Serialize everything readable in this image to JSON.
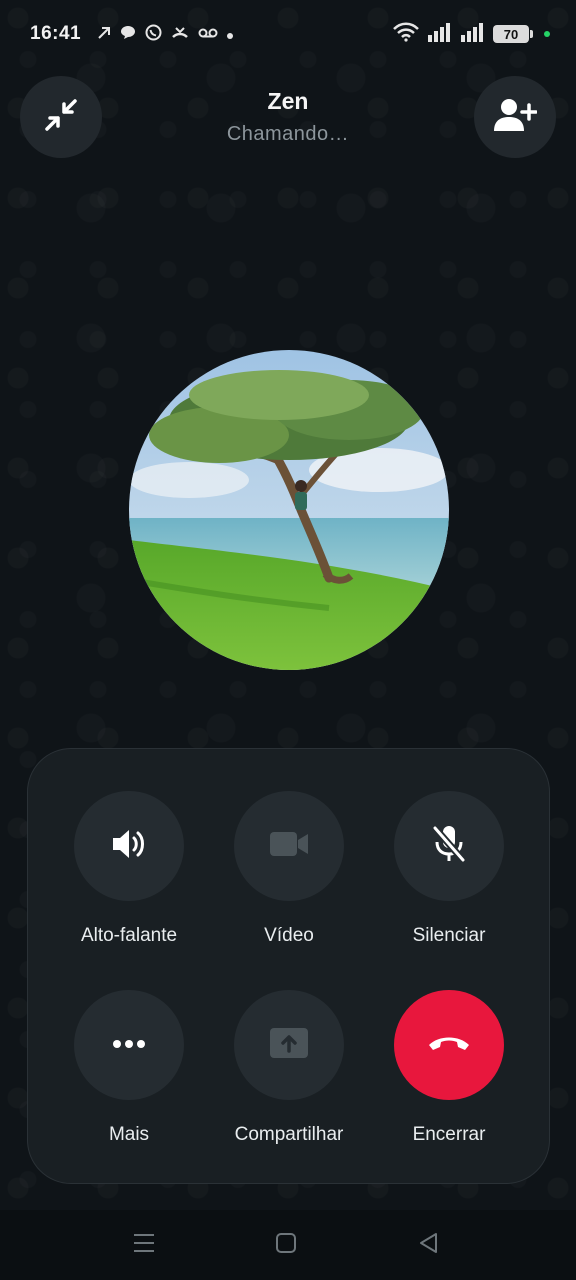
{
  "status_bar": {
    "time": "16:41",
    "battery": "70",
    "notification_icons": [
      "arrow-icon",
      "chat-bubble-icon",
      "whatsapp-icon",
      "missed-call-icon",
      "voicemail-icon",
      "dot-icon"
    ],
    "system_icons": [
      "wifi-icon",
      "signal-icon",
      "signal-icon",
      "battery-icon"
    ],
    "accent_dot_color": "#25d366"
  },
  "header": {
    "contact_name": "Zen",
    "call_status": "Chamando…",
    "left_button_icon": "minimize-icon",
    "right_button_icon": "add-person-icon"
  },
  "controls": [
    {
      "id": "speaker",
      "label": "Alto-falante",
      "icon": "speaker-icon"
    },
    {
      "id": "video",
      "label": "Vídeo",
      "icon": "video-camera-icon"
    },
    {
      "id": "mute",
      "label": "Silenciar",
      "icon": "microphone-off-icon"
    },
    {
      "id": "more",
      "label": "Mais",
      "icon": "more-dots-icon"
    },
    {
      "id": "share",
      "label": "Compartilhar",
      "icon": "share-screen-icon"
    },
    {
      "id": "end",
      "label": "Encerrar",
      "icon": "end-call-icon"
    }
  ],
  "colors": {
    "background": "#0f1418",
    "panel": "#191f23",
    "button": "#252c31",
    "end_call": "#e8173d"
  },
  "nav_bar": {
    "icons": [
      "menu-icon",
      "home-icon",
      "back-icon"
    ]
  }
}
